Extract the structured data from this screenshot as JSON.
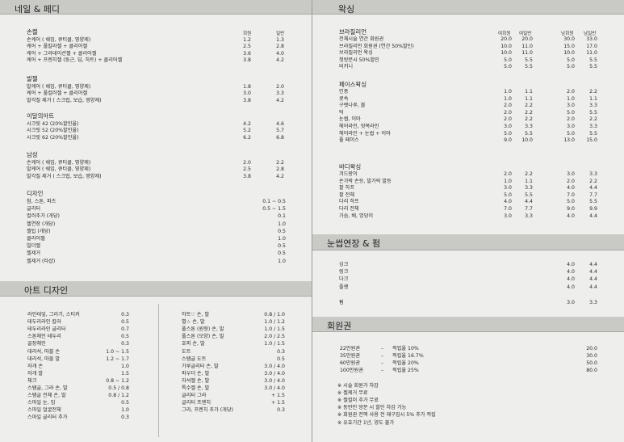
{
  "nail": {
    "title": "네일 & 페디",
    "cols": [
      "회원",
      "일반"
    ],
    "groups": [
      {
        "title": "손켈",
        "rows": [
          [
            "손케어 ( 쉐입, 큐티클, 영양제)",
            "1.2",
            "1.3"
          ],
          [
            "케어 + 풀칼라젤 + 클리어젤",
            "2.5",
            "2.8"
          ],
          [
            "케어 + 그라데이션젤 + 클리어젤",
            "3.6",
            "4.0"
          ],
          [
            "케어 + 프렌치젤 (둥근, 딥, 하트) + 클리어젤",
            "3.8",
            "4.2"
          ]
        ]
      },
      {
        "title": "발젤",
        "rows": [
          [
            "발케어 ( 쉐입, 큐티클, 영양제)",
            "1.8",
            "2.0"
          ],
          [
            "케어 + 풀컬러젤 + 클리어젤",
            "3.0",
            "3.3"
          ],
          [
            "발각질 제거 ( 스크럽, 보습, 영양제)",
            "3.8",
            "4.2"
          ]
        ]
      },
      {
        "title": "이달의아트",
        "rows": [
          [
            "시크릿 42 (20%할인율)",
            "4.2",
            "4.6"
          ],
          [
            "시크릿 52 (20%할인율)",
            "5.2",
            "5.7"
          ],
          [
            "시크릿 62 (20%할인율)",
            "6.2",
            "6.8"
          ]
        ]
      },
      {
        "title": "남성",
        "rows": [
          [
            "손케어 ( 쉐입, 큐티클, 영양제)",
            "2.0",
            "2.2"
          ],
          [
            "발케어 ( 쉐입, 큐티클, 영양제)",
            "2.5",
            "2.8"
          ],
          [
            "발각질 제거 ( 스크럽, 보습, 영양제)",
            "3.8",
            "4.2"
          ]
        ]
      }
    ],
    "design": {
      "title": "디자인",
      "rows": [
        [
          "참, 스톤, 파츠",
          "0.1 ~ 0.5"
        ],
        [
          "글리터",
          "0.5 ~ 1.5"
        ],
        [
          "컬러추가 (개당)",
          "0.1"
        ],
        [
          "젤연장 (개당)",
          "1.0"
        ],
        [
          "젤팁 (개당)",
          "0.5"
        ],
        [
          "클리어젤",
          "1.0"
        ],
        [
          "빌더젤",
          "0.5"
        ],
        [
          "젤제거",
          "0.5"
        ],
        [
          "젤제거 (타샵)",
          "1.0"
        ]
      ]
    }
  },
  "art": {
    "title": "아트 디자인",
    "left": [
      [
        "라인테잎, 그리기, 스티커",
        "0.3"
      ],
      [
        "테두리라인 칼라",
        "0.5"
      ],
      [
        "테두리라인 글리터",
        "0.7"
      ],
      [
        "스톤체인 테두리",
        "0.5"
      ],
      [
        "골장체인",
        "0.3"
      ],
      [
        "대리석, 마블 손",
        "1.0 ~ 1.5"
      ],
      [
        "대리석, 마블 발",
        "1.2 ~ 1.7"
      ],
      [
        "자개 손",
        "1.0"
      ],
      [
        "자개 발",
        "1.5"
      ],
      [
        "체크",
        "0.8 ~ 1.2"
      ],
      [
        "스탬글, 그라 손, 발",
        "0.5 / 0.8"
      ],
      [
        "스탬글 전체 손, 발",
        "0.8 / 1.2"
      ],
      [
        "스마일 눈, 입",
        "0.5"
      ],
      [
        "스마일 얼굴전체",
        "1.0"
      ],
      [
        "스마일 글리터 추가",
        "0.3"
      ]
    ],
    "right": [
      [
        "하트♡ 손, 발",
        "0.8 / 1.0"
      ],
      [
        "별☆ 손, 발",
        "1.0 / 1.2"
      ],
      [
        "풀스톤 (원형) 손, 발",
        "1.0 / 1.5"
      ],
      [
        "풀스톤 (모양) 손, 발",
        "2.0 / 2.5"
      ],
      [
        "호피 손, 발",
        "1.0 / 1.5"
      ],
      [
        "도트",
        "0.3"
      ],
      [
        "스탬글 도트",
        "0.5"
      ],
      [
        "가루글리터 손, 발",
        "3.0 / 4.0"
      ],
      [
        "파우더 손, 발",
        "3.0 / 4.0"
      ],
      [
        "자석젤 손, 발",
        "3.0 / 4.0"
      ],
      [
        "특수젤 손, 발",
        "3.0 / 4.0"
      ],
      [
        "글리터 그라",
        "+ 1.5"
      ],
      [
        "글리터 프렌치",
        "+ 1.5"
      ],
      [
        "그라, 프렌치 추가 (개당)",
        "0.3"
      ]
    ]
  },
  "waxing": {
    "title": "왁싱",
    "cols": [
      "여회원",
      "여일반",
      "남회원",
      "남일반"
    ],
    "groups": [
      {
        "title": "브라질리언",
        "rows": [
          [
            "전체시술 연간 회원권",
            "20.0",
            "20.0",
            "30.0",
            "33.0"
          ],
          [
            "브라질리언 회원권 (연간 50%할인)",
            "10.0",
            "11.0",
            "15.0",
            "17.0"
          ],
          [
            "브라질리언 왁싱",
            "10.0",
            "11.0",
            "10.0",
            "11.0"
          ],
          [
            "첫방문시 50%할인",
            "5.0",
            "5.5",
            "5.0",
            "5.5"
          ],
          [
            "비키니",
            "5.0",
            "5.5",
            "5.0",
            "5.5"
          ]
        ]
      },
      {
        "title": "페이스왁싱",
        "rows": [
          [
            "인중",
            "1.0",
            "1.1",
            "2.0",
            "2.2"
          ],
          [
            "콧속",
            "1.0",
            "1.1",
            "1.0",
            "1.1"
          ],
          [
            "구렛나루, 볼",
            "2.0",
            "2.2",
            "3.0",
            "3.3"
          ],
          [
            "턱",
            "2.0",
            "2.2",
            "5.0",
            "5.5"
          ],
          [
            "눈썹, 이마",
            "2.0",
            "2.2",
            "2.0",
            "2.2"
          ],
          [
            "헤어라인, 뒷목라인",
            "3.0",
            "3.3",
            "3.0",
            "3.3"
          ],
          [
            "헤어라인 + 눈썹 + 이마",
            "5.0",
            "5.5",
            "5.0",
            "5.5"
          ],
          [
            "풀 페이스",
            "9.0",
            "10.0",
            "13.0",
            "15.0"
          ]
        ]
      },
      {
        "title": "바디왁싱",
        "rows": [
          [
            "겨드랑이",
            "2.0",
            "2.2",
            "3.0",
            "3.3"
          ],
          [
            "손가락 손등, 발가락 발등",
            "1.0",
            "1.1",
            "2.0",
            "2.2"
          ],
          [
            "팔 하프",
            "3.0",
            "3.3",
            "4.0",
            "4.4"
          ],
          [
            "팔 전체",
            "5.0",
            "5.5",
            "7.0",
            "7.7"
          ],
          [
            "다리 하프",
            "4.0",
            "4.4",
            "5.0",
            "5.5"
          ],
          [
            "다리 전체",
            "7.0",
            "7.7",
            "9.0",
            "9.9"
          ],
          [
            "가슴, 배, 엉덩이",
            "3.0",
            "3.3",
            "4.0",
            "4.4"
          ]
        ]
      }
    ]
  },
  "lash": {
    "title": "눈썹연장 & 펌",
    "rows": [
      [
        "싱크",
        "4.0",
        "4.4"
      ],
      [
        "링크",
        "4.0",
        "4.4"
      ],
      [
        "다크",
        "4.0",
        "4.4"
      ],
      [
        "플랫",
        "4.0",
        "4.4"
      ]
    ],
    "perm": [
      "펌",
      "3.0",
      "3.3"
    ]
  },
  "membership": {
    "title": "회원권",
    "rows": [
      [
        "22만원권",
        "–",
        "적립율 10%",
        "20.0"
      ],
      [
        "35만원권",
        "–",
        "적립율 16.7%",
        "30.0"
      ],
      [
        "60만원권",
        "–",
        "적립율 20%",
        "50.0"
      ],
      [
        "100만원권",
        "–",
        "적립율 25%",
        "80.0"
      ]
    ],
    "notes": [
      "※ 시술 회원가 차감",
      "※ 젤제거 무료",
      "※ 젤컬러 추가 무료",
      "※ 동반인 방문 시 할인 차감 가능",
      "※ 회원권 전액 사용 전 재구입시 5% 추가 적립",
      "※ 유효기간 1년, 양도 불가"
    ]
  }
}
